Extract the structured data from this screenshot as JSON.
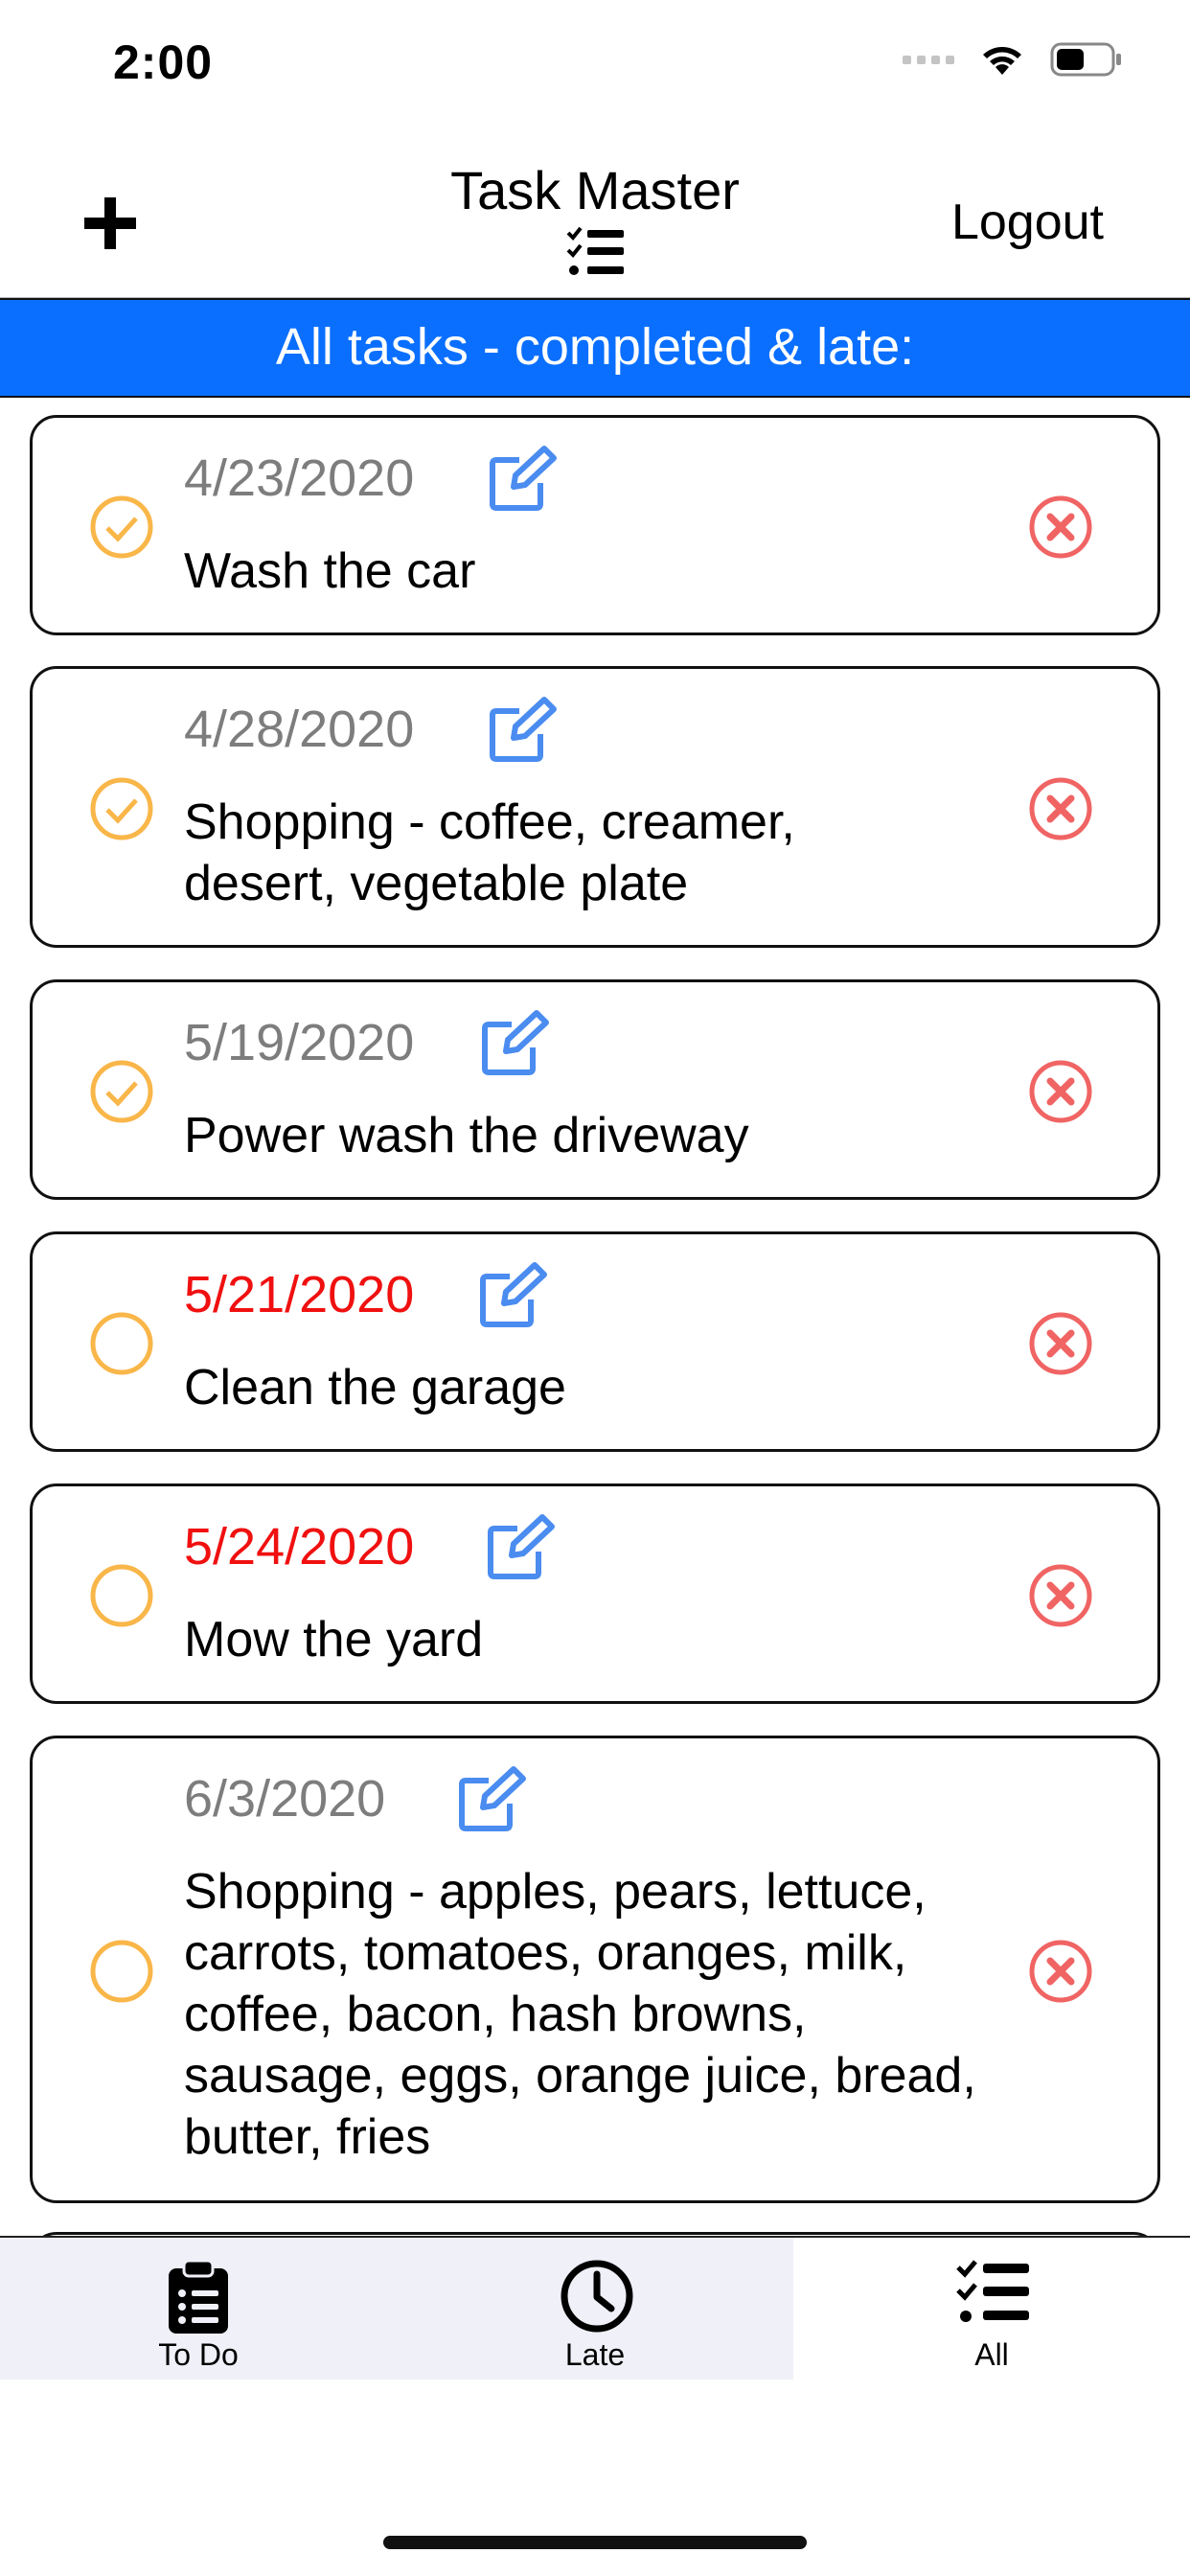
{
  "status_bar": {
    "time": "2:00",
    "icons": [
      "signal-icon",
      "wifi-icon",
      "battery-icon"
    ]
  },
  "header": {
    "title": "Task Master",
    "title_icon": "checklist-icon",
    "add_icon": "plus-icon",
    "logout_label": "Logout"
  },
  "banner": {
    "text": "All tasks - completed & late:",
    "color": "#0a6fff"
  },
  "colors": {
    "completed_check": "#f9b649",
    "late_date": "#f01010",
    "normal_date": "#7d7d7d",
    "edit_icon": "#4a8cf0",
    "delete_icon": "#f06464"
  },
  "tasks": [
    {
      "date": "4/23/2020",
      "text": "Wash the car",
      "completed": true,
      "late": false
    },
    {
      "date": "4/28/2020",
      "text": "Shopping - coffee, creamer, desert, vegetable plate",
      "completed": true,
      "late": false
    },
    {
      "date": "5/19/2020",
      "text": "Power wash the driveway",
      "completed": true,
      "late": false
    },
    {
      "date": "5/21/2020",
      "text": "Clean the garage",
      "completed": false,
      "late": true
    },
    {
      "date": "5/24/2020",
      "text": "Mow the yard",
      "completed": false,
      "late": true
    },
    {
      "date": "6/3/2020",
      "text": "Shopping - apples, pears, lettuce, carrots, tomatoes, oranges, milk, coffee, bacon, hash browns, sausage, eggs, orange juice, bread, butter, fries",
      "completed": false,
      "late": false
    }
  ],
  "tabs": [
    {
      "label": "To Do",
      "icon": "clipboard-icon",
      "selected": false
    },
    {
      "label": "Late",
      "icon": "clock-icon",
      "selected": false
    },
    {
      "label": "All",
      "icon": "checklist-icon",
      "selected": true
    }
  ]
}
